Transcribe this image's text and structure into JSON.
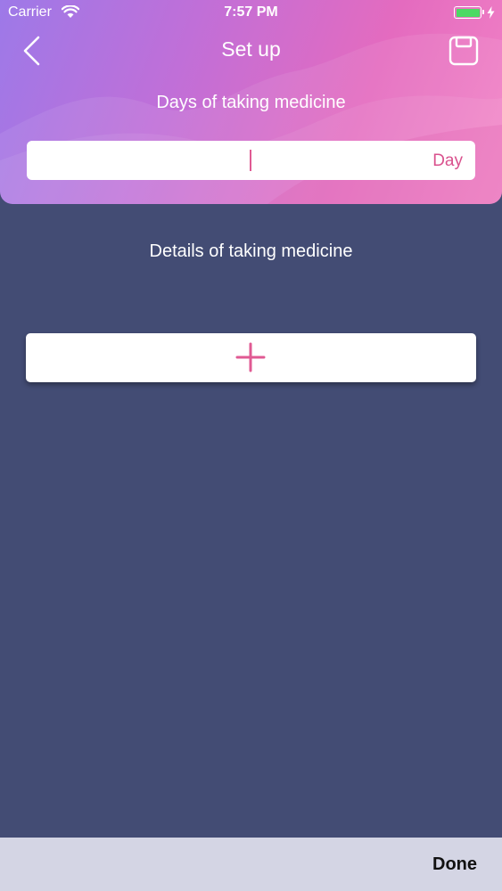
{
  "status_bar": {
    "carrier": "Carrier",
    "time": "7:57 PM",
    "battery_level": 1.0
  },
  "nav": {
    "title": "Set up",
    "back_icon": "chevron-left-icon",
    "save_icon": "floppy-disk-icon"
  },
  "days": {
    "label": "Days of taking medicine",
    "value": "",
    "unit": "Day"
  },
  "details": {
    "label": "Details of taking medicine",
    "add_icon": "plus-icon"
  },
  "toolbar": {
    "done_label": "Done"
  },
  "colors": {
    "background": "#434c74",
    "header_gradient_start": "#9d79e8",
    "header_gradient_end": "#f283c6",
    "accent": "#e05a93",
    "toolbar": "#d4d5e4"
  }
}
